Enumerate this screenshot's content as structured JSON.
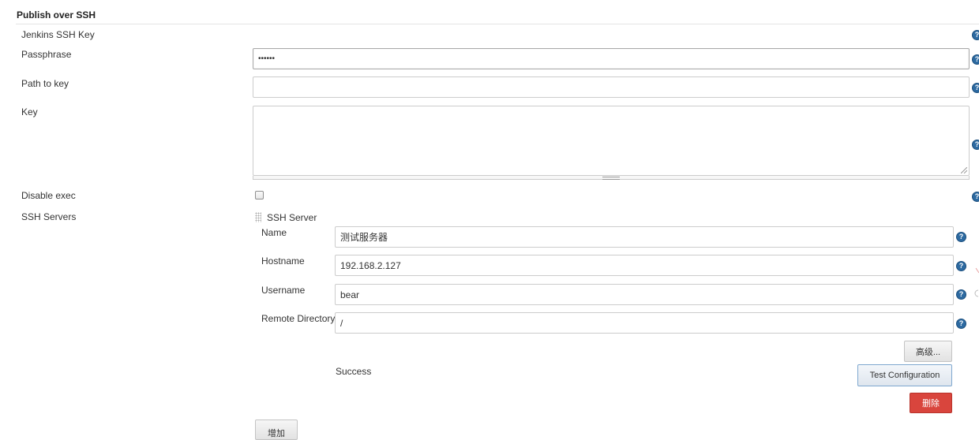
{
  "section": {
    "title": "Publish over SSH"
  },
  "fields": {
    "jenkins_ssh_key": {
      "label": "Jenkins SSH Key"
    },
    "passphrase": {
      "label": "Passphrase",
      "value": "••••••"
    },
    "path_to_key": {
      "label": "Path to key",
      "value": ""
    },
    "key": {
      "label": "Key",
      "value": ""
    },
    "disable_exec": {
      "label": "Disable exec",
      "checked": false
    }
  },
  "ssh_servers": {
    "label": "SSH Servers",
    "server": {
      "header": "SSH Server",
      "name": {
        "label": "Name",
        "value": "测试服务器"
      },
      "hostname": {
        "label": "Hostname",
        "value": "192.168.2.127"
      },
      "username": {
        "label": "Username",
        "value": "bear"
      },
      "remote_directory": {
        "label": "Remote Directory",
        "value": "/"
      },
      "advanced_button": "高级...",
      "status": "Success",
      "test_button": "Test Configuration",
      "delete_button": "删除"
    },
    "add_button": "增加"
  },
  "icons": {
    "help": "help-question-icon",
    "drag": "drag-handle-icon"
  },
  "colors": {
    "help_icon": "#2d6aa1",
    "danger_button": "#d9453d",
    "border": "#cccccc"
  }
}
